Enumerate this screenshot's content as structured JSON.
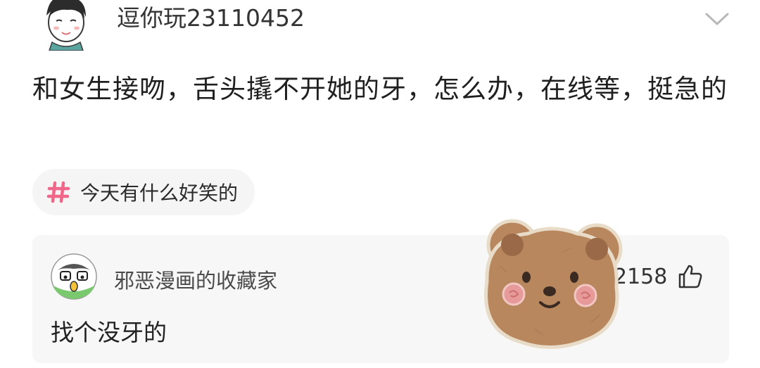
{
  "post": {
    "author": "逗你玩23110452",
    "question": "和女生接吻，舌头撬不开她的牙，怎么办，在线等，挺急的",
    "topic": "今天有什么好笑的"
  },
  "comment": {
    "author": "邪恶漫画的收藏家",
    "text": "找个没牙的",
    "likes": "2158"
  },
  "icons": {
    "more": "chevron-down-icon",
    "topic": "hashtag-icon",
    "like": "thumbs-up-icon"
  },
  "colors": {
    "topic_accent": "#f0678a",
    "card_bg": "#f7f7f7",
    "chip_bg": "#f5f5f5"
  }
}
